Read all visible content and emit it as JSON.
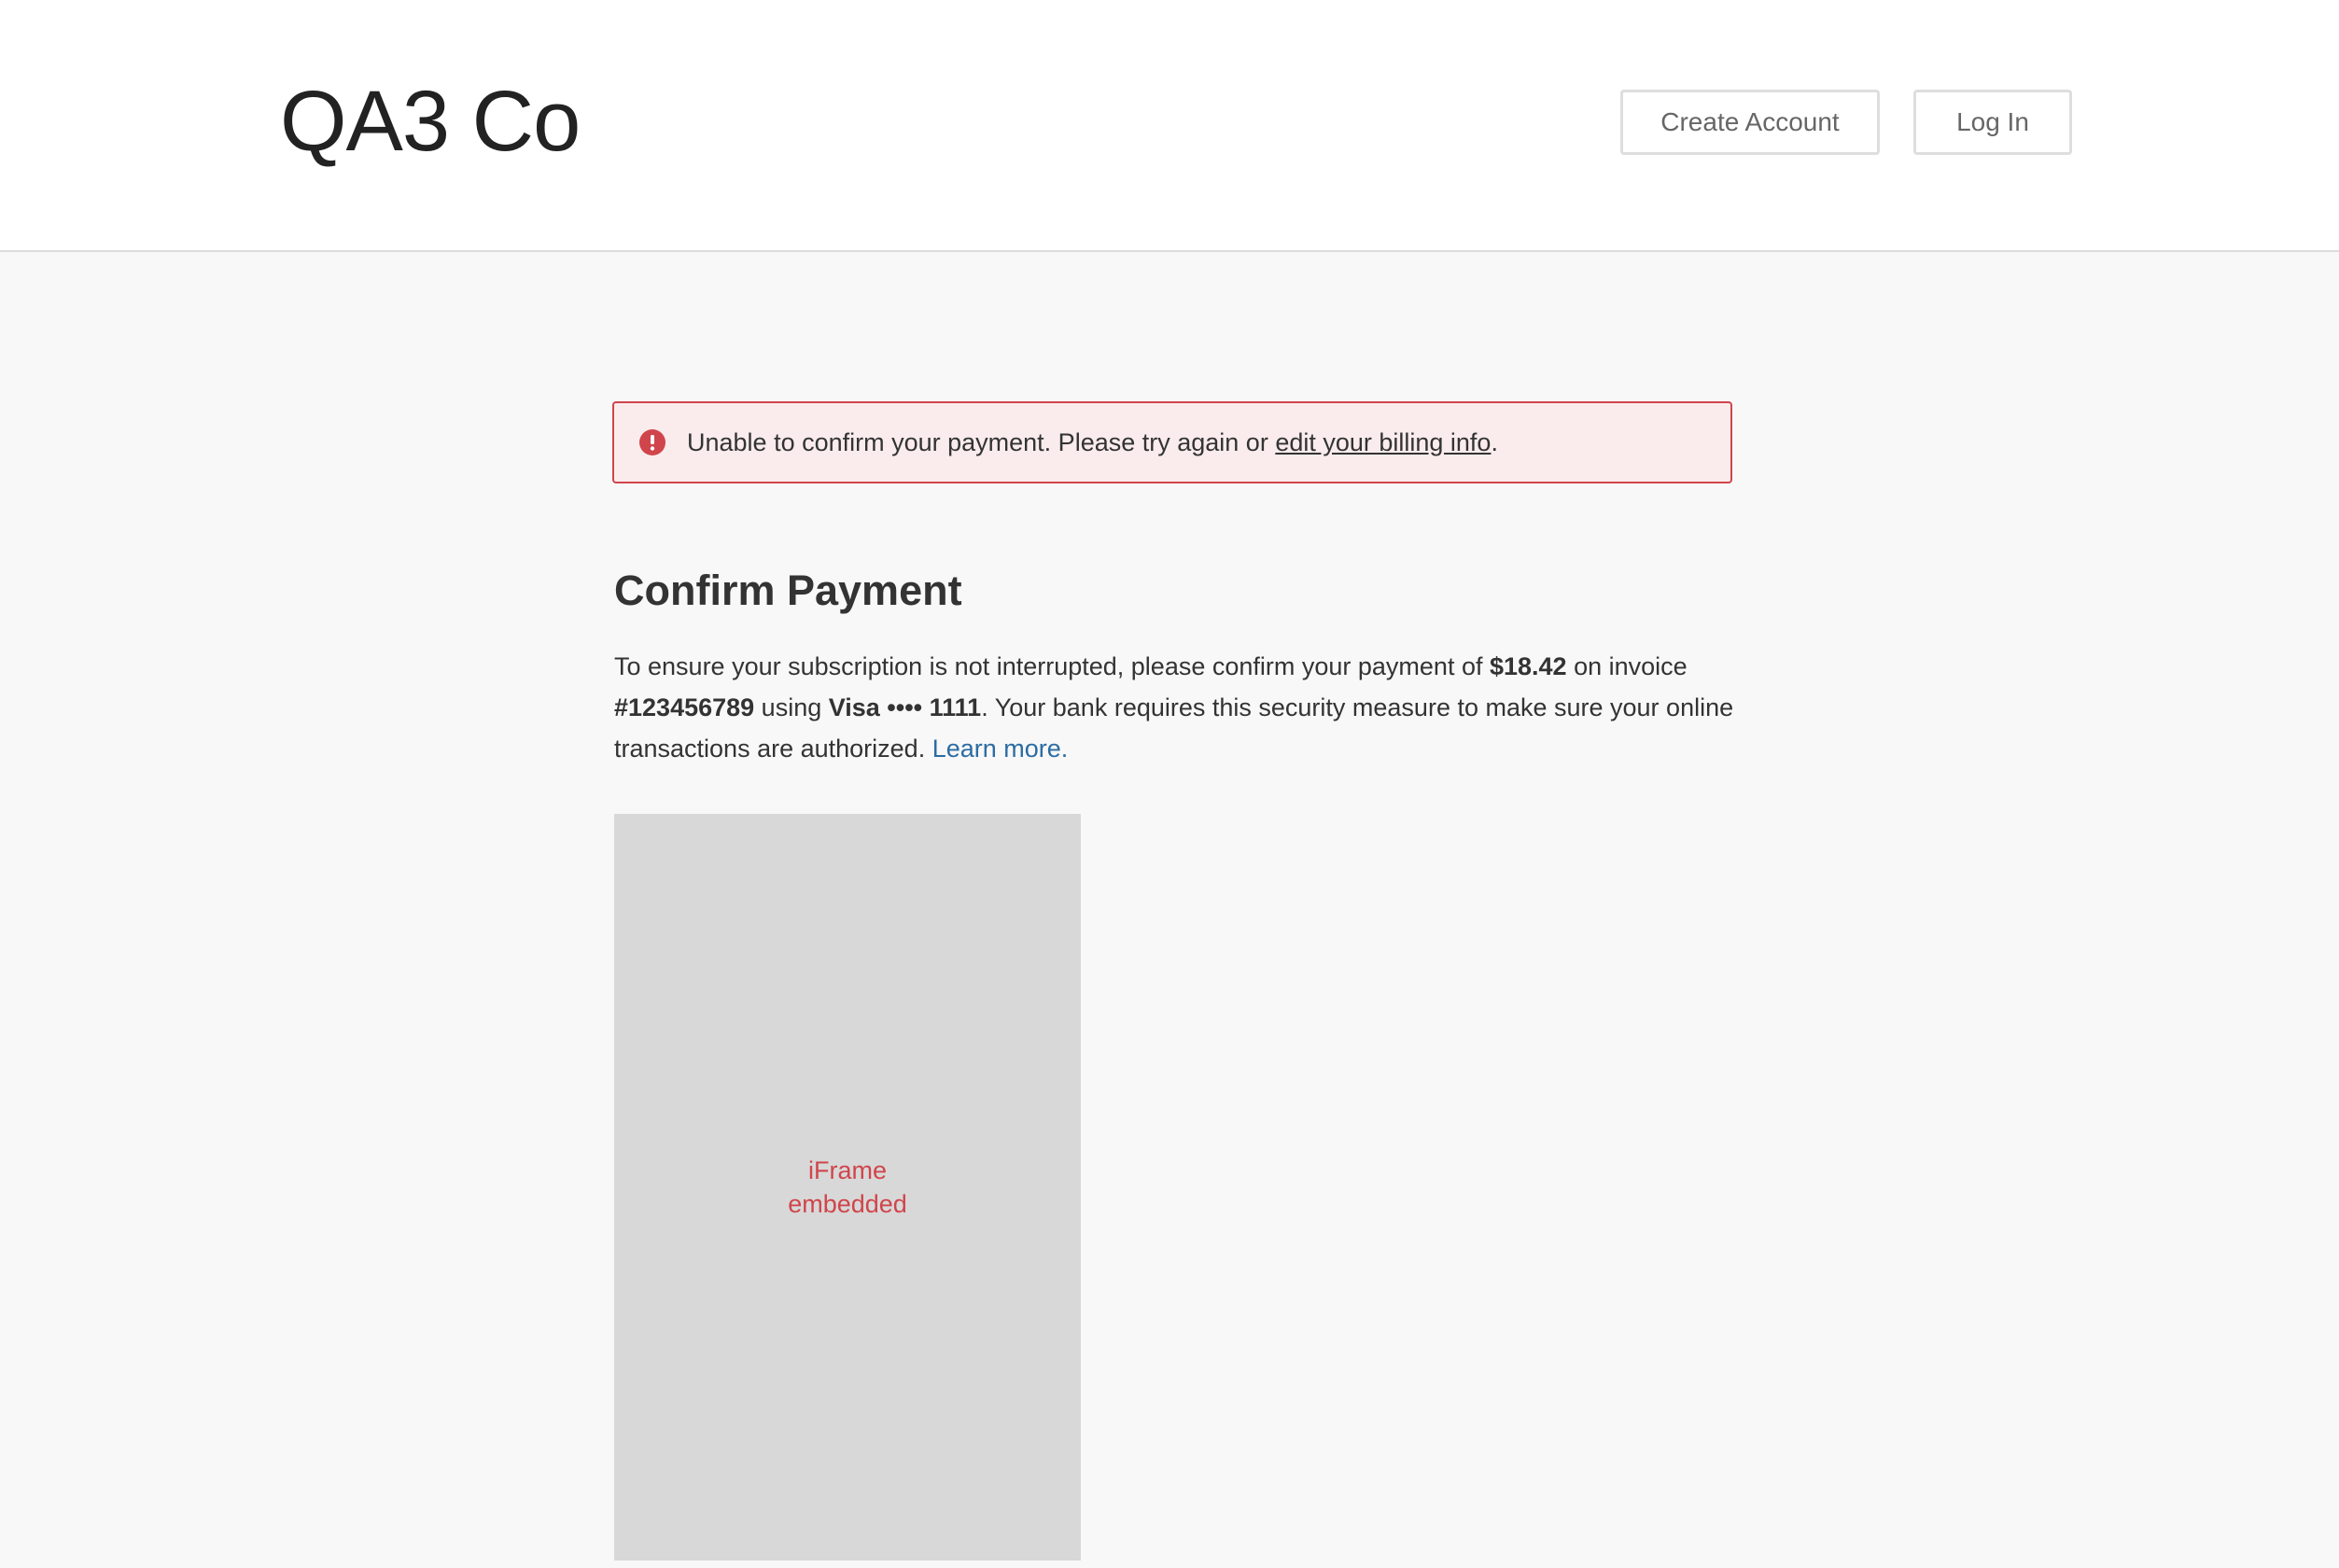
{
  "header": {
    "brand": "QA3 Co",
    "create_account_label": "Create Account",
    "login_label": "Log In"
  },
  "alert": {
    "message": "Unable to confirm your payment. Please try again or ",
    "link_text": "edit your billing info",
    "suffix": ".",
    "icon": "exclamation-circle-icon",
    "color": "#d0454b"
  },
  "main": {
    "title": "Confirm Payment",
    "intro": {
      "part1": "To ensure your subscription is not interrupted, please confirm your payment of ",
      "amount": "$18.42",
      "part2": " on invoice ",
      "invoice": "#123456789",
      "part3": " using ",
      "card": "Visa •••• 1111",
      "part4": ". Your bank requires this security measure to make sure your online transactions are authorized. ",
      "learn_more": "Learn more."
    },
    "iframe_label": "iFrame embedded"
  },
  "colors": {
    "link": "#2b6ca3",
    "error": "#d0454b",
    "page_background": "#f8f8f8"
  }
}
